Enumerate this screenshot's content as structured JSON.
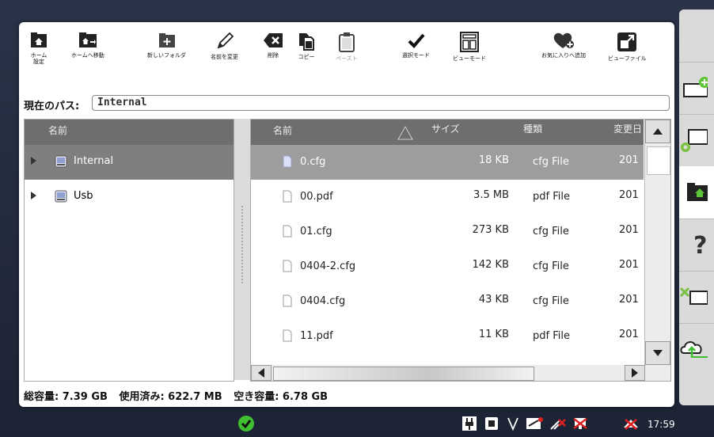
{
  "toolbar": {
    "home_settings": "ホーム\n設定",
    "go_home": "ホームへ移動",
    "new_folder": "新しいフォルダ",
    "rename": "名前を変更",
    "delete": "削除",
    "copy": "コピー",
    "paste": "ペースト",
    "select_mode": "選択モード",
    "view_mode": "ビューモード",
    "add_favorite": "お気に入りへ追加",
    "view_file": "ビューファイル"
  },
  "path": {
    "label": "現在のパス:",
    "value": "Internal"
  },
  "tree": {
    "header": "名前",
    "items": [
      {
        "label": "Internal",
        "selected": true
      },
      {
        "label": "Usb",
        "selected": false
      }
    ]
  },
  "list": {
    "headers": {
      "name": "名前",
      "size": "サイズ",
      "type": "種類",
      "modified": "変更日"
    },
    "rows": [
      {
        "name": "0.cfg",
        "size": "18 KB",
        "type": "cfg File",
        "date": "201",
        "selected": true
      },
      {
        "name": "00.pdf",
        "size": "3.5 MB",
        "type": "pdf File",
        "date": "201",
        "selected": false
      },
      {
        "name": "01.cfg",
        "size": "273 KB",
        "type": "cfg File",
        "date": "201",
        "selected": false
      },
      {
        "name": "0404-2.cfg",
        "size": "142 KB",
        "type": "cfg File",
        "date": "201",
        "selected": false
      },
      {
        "name": "0404.cfg",
        "size": "43 KB",
        "type": "cfg File",
        "date": "201",
        "selected": false
      },
      {
        "name": "11.pdf",
        "size": "11 KB",
        "type": "pdf File",
        "date": "201",
        "selected": false
      }
    ]
  },
  "status": {
    "total": "総容量: 7.39 GB",
    "used": "使用済み: 622.7 MB",
    "free": "空き容量: 6.78 GB"
  },
  "clock": "17:59",
  "colors": {
    "selected_row": "#9d9d9d",
    "header": "#6e6e6e",
    "ok_green": "#3fbf2f"
  }
}
